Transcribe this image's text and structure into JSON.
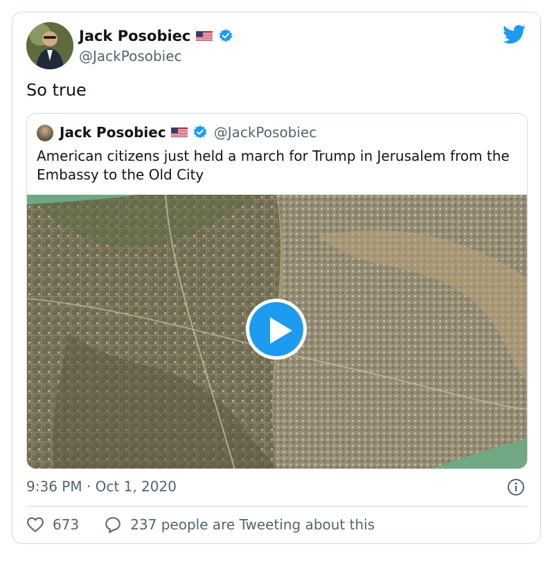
{
  "author": {
    "name": "Jack Posobiec",
    "handle": "@JackPosobiec"
  },
  "tweet": {
    "text": "So true",
    "timestamp": "9:36 PM · Oct 1, 2020"
  },
  "quoted_tweet": {
    "name": "Jack Posobiec",
    "handle": "@JackPosobiec",
    "text": "American citizens just held a march for Trump in Jerusalem from the Embassy to the Old City"
  },
  "stats": {
    "likes": "673",
    "talking": "237 people are Tweeting about this"
  },
  "colors": {
    "twitter_blue": "#1d9bf0",
    "secondary_text": "#536471",
    "border": "#cfd9de"
  },
  "icons": [
    "twitter-bird-icon",
    "verified-badge-icon",
    "us-flag-icon",
    "play-icon",
    "info-icon",
    "heart-icon",
    "reply-bubble-icon"
  ]
}
